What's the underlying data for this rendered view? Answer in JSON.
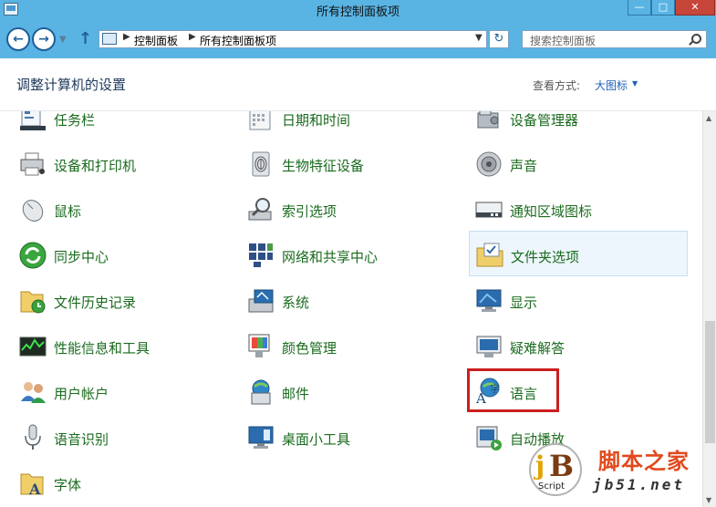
{
  "window": {
    "title": "所有控制面板项"
  },
  "nav": {
    "breadcrumb": [
      "控制面板",
      "所有控制面板项"
    ],
    "search_placeholder": "搜索控制面板"
  },
  "header": {
    "title": "调整计算机的设置",
    "view_label": "查看方式:",
    "view_value": "大图标"
  },
  "items": [
    {
      "label": "任务栏",
      "icon": "taskbar-icon"
    },
    {
      "label": "日期和时间",
      "icon": "calendar-clock-icon"
    },
    {
      "label": "设备管理器",
      "icon": "device-manager-icon"
    },
    {
      "label": "设备和打印机",
      "icon": "printer-icon"
    },
    {
      "label": "生物特征设备",
      "icon": "fingerprint-icon"
    },
    {
      "label": "声音",
      "icon": "speaker-icon"
    },
    {
      "label": "鼠标",
      "icon": "mouse-icon"
    },
    {
      "label": "索引选项",
      "icon": "index-search-icon"
    },
    {
      "label": "通知区域图标",
      "icon": "notification-area-icon"
    },
    {
      "label": "同步中心",
      "icon": "sync-icon"
    },
    {
      "label": "网络和共享中心",
      "icon": "network-icon"
    },
    {
      "label": "文件夹选项",
      "icon": "folder-options-icon"
    },
    {
      "label": "文件历史记录",
      "icon": "file-history-icon"
    },
    {
      "label": "系统",
      "icon": "system-icon"
    },
    {
      "label": "显示",
      "icon": "display-icon"
    },
    {
      "label": "性能信息和工具",
      "icon": "performance-icon"
    },
    {
      "label": "颜色管理",
      "icon": "color-management-icon"
    },
    {
      "label": "疑难解答",
      "icon": "troubleshooting-icon"
    },
    {
      "label": "用户帐户",
      "icon": "user-accounts-icon"
    },
    {
      "label": "邮件",
      "icon": "mail-icon"
    },
    {
      "label": "语言",
      "icon": "language-icon"
    },
    {
      "label": "语音识别",
      "icon": "microphone-icon"
    },
    {
      "label": "桌面小工具",
      "icon": "gadgets-icon"
    },
    {
      "label": "自动播放",
      "icon": "autoplay-icon"
    },
    {
      "label": "字体",
      "icon": "font-icon"
    }
  ],
  "watermark": {
    "site": "脚本之家",
    "url": "jb51.net",
    "logo_script": "Script",
    "logo_letters": "jB"
  },
  "colors": {
    "titlebar": "#59b4e3",
    "item_text": "#1a6b1e",
    "highlight": "#cc1f1f",
    "link": "#1f61b8"
  }
}
